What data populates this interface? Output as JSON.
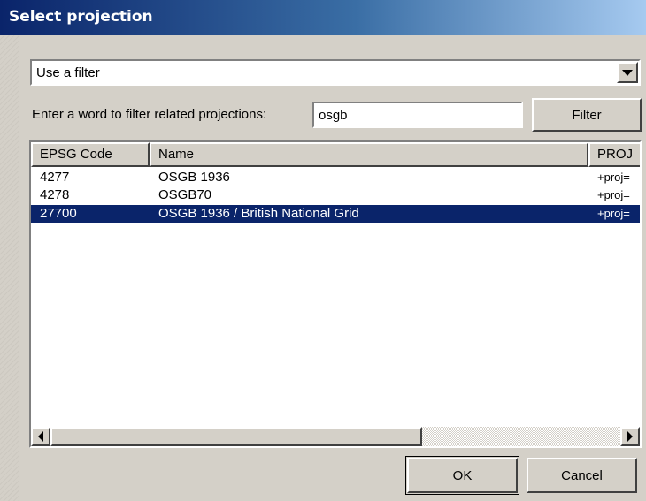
{
  "window": {
    "title": "Select projection"
  },
  "mode_select": {
    "value": "Use a filter"
  },
  "filter": {
    "label": "Enter a word to filter related projections:",
    "value": "osgb",
    "button_label": "Filter"
  },
  "table": {
    "columns": [
      "EPSG Code",
      "Name",
      "PROJ"
    ],
    "rows": [
      {
        "code": "4277",
        "name": "OSGB 1936",
        "proj": "+proj="
      },
      {
        "code": "4278",
        "name": "OSGB70",
        "proj": "+proj="
      },
      {
        "code": "27700",
        "name": "OSGB 1936 / British National Grid",
        "proj": "+proj="
      }
    ],
    "selected_row": 2
  },
  "buttons": {
    "ok": "OK",
    "cancel": "Cancel"
  },
  "colors": {
    "selection": "#0a246a",
    "title_start": "#0a246a",
    "face": "#d4d0c8"
  }
}
